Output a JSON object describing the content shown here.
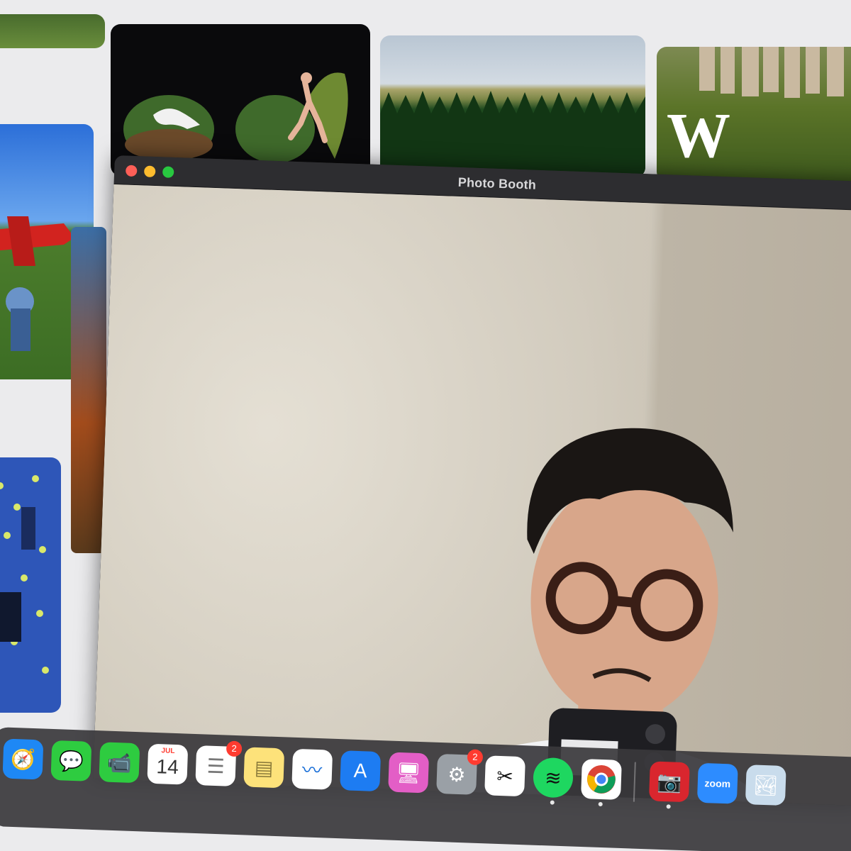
{
  "window": {
    "title": "Photo Booth",
    "traffic_lights": {
      "close": "#fe5f57",
      "minimize": "#febc2e",
      "zoom": "#28c840"
    }
  },
  "background_grid": {
    "tiles": [
      {
        "name": "grass-photo"
      },
      {
        "name": "binocular-illustration"
      },
      {
        "name": "forest-photo"
      },
      {
        "name": "fashion-photo",
        "text": "W"
      },
      {
        "name": "airplane-photo"
      },
      {
        "name": "tennis-photo"
      },
      {
        "name": "strip-photo"
      }
    ]
  },
  "dock": {
    "apps": [
      {
        "name": "safari",
        "icon": "compass-icon",
        "color": "#1e88f5",
        "badge": ""
      },
      {
        "name": "messages",
        "icon": "speech-bubble-icon",
        "color": "#2ecc40",
        "badge": ""
      },
      {
        "name": "facetime",
        "icon": "video-camera-icon",
        "color": "#2ecc40",
        "badge": ""
      },
      {
        "name": "calendar",
        "icon": "calendar-icon",
        "color": "#ffffff",
        "month": "JUL",
        "day": "14",
        "badge": ""
      },
      {
        "name": "reminders",
        "icon": "list-icon",
        "color": "#ffffff",
        "badge": "2"
      },
      {
        "name": "notes",
        "icon": "notepad-icon",
        "color": "#fde27a",
        "badge": ""
      },
      {
        "name": "freeform",
        "icon": "scribble-icon",
        "color": "#ffffff",
        "badge": ""
      },
      {
        "name": "app-store",
        "icon": "app-store-icon",
        "color": "#1d7cf2",
        "badge": ""
      },
      {
        "name": "screen-sharing",
        "icon": "monitor-icon",
        "color": "#e35ec6",
        "badge": ""
      },
      {
        "name": "system-settings",
        "icon": "gear-icon",
        "color": "#9aa0a6",
        "badge": "2"
      },
      {
        "name": "capcut",
        "icon": "capcut-icon",
        "color": "#ffffff",
        "badge": ""
      },
      {
        "name": "spotify",
        "icon": "spotify-icon",
        "color": "#1ed760",
        "badge": ""
      },
      {
        "name": "chrome",
        "icon": "chrome-icon",
        "color": "#ffffff",
        "badge": ""
      },
      {
        "name": "photo-booth",
        "icon": "photo-booth-icon",
        "color": "#d9262e",
        "badge": ""
      },
      {
        "name": "zoom",
        "icon": "zoom-icon",
        "color": "#2d8cff",
        "label": "zoom",
        "badge": ""
      },
      {
        "name": "preview",
        "icon": "photo-icon",
        "color": "#c9dcec",
        "badge": ""
      }
    ]
  }
}
